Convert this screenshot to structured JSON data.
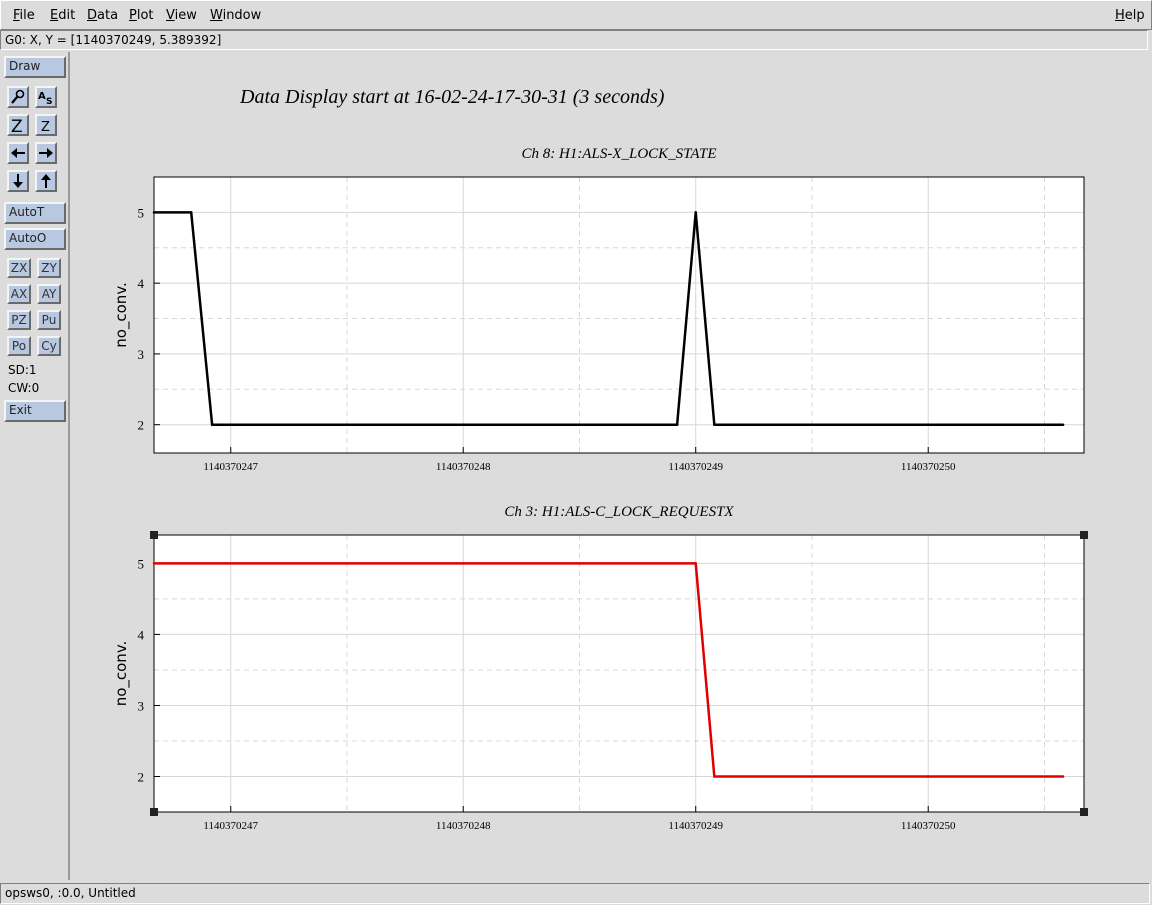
{
  "menu": {
    "file": "File",
    "edit": "Edit",
    "data": "Data",
    "plot": "Plot",
    "view": "View",
    "window": "Window",
    "help": "Help"
  },
  "coord_readout": "G0: X, Y = [1140370249, 5.389392]",
  "sidebar": {
    "draw": "Draw",
    "autot": "AutoT",
    "autoo": "AutoO",
    "zx": "ZX",
    "zy": "ZY",
    "ax": "AX",
    "ay": "AY",
    "pz": "PZ",
    "pu": "Pu",
    "po": "Po",
    "cy": "Cy",
    "sd": "SD:1",
    "cw": "CW:0",
    "exit": "Exit",
    "icons": [
      "zoom-icon",
      "text-tool-icon",
      "zoom-in-z-icon",
      "zoom-out-z-icon",
      "arrow-left-icon",
      "arrow-right-icon",
      "arrow-down-icon",
      "arrow-up-icon"
    ]
  },
  "page_title": "Data Display start at 16-02-24-17-30-31 (3 seconds)",
  "status_bottom": "opsws0, :0.0, Untitled",
  "chart_data": [
    {
      "type": "line",
      "title": "Ch 8: H1:ALS-X_LOCK_STATE",
      "ylabel": "no_conv.",
      "xlabel": "",
      "xlim": [
        1140370246.67,
        1140370250.67
      ],
      "ylim": [
        1.6,
        5.5
      ],
      "xticks": [
        1140370247,
        1140370248,
        1140370249,
        1140370250
      ],
      "xtick_labels": [
        "1140370247",
        "1140370248",
        "1140370249",
        "1140370250"
      ],
      "yticks": [
        2,
        3,
        4,
        5
      ],
      "ytick_labels": [
        "2",
        "3",
        "4",
        "5"
      ],
      "grid": true,
      "color": "#000000",
      "x": [
        1140370246.67,
        1140370246.83,
        1140370246.92,
        1140370248.92,
        1140370249.0,
        1140370249.08,
        1140370250.58
      ],
      "y": [
        5,
        5,
        2,
        2,
        5,
        2,
        2
      ]
    },
    {
      "type": "line",
      "title": "Ch 3: H1:ALS-C_LOCK_REQUESTX",
      "ylabel": "no_conv.",
      "xlabel": "",
      "xlim": [
        1140370246.67,
        1140370250.67
      ],
      "ylim": [
        1.5,
        5.4
      ],
      "xticks": [
        1140370247,
        1140370248,
        1140370249,
        1140370250
      ],
      "xtick_labels": [
        "1140370247",
        "1140370248",
        "1140370249",
        "1140370250"
      ],
      "yticks": [
        2,
        3,
        4,
        5
      ],
      "ytick_labels": [
        "2",
        "3",
        "4",
        "5"
      ],
      "grid": true,
      "color": "#e00000",
      "x": [
        1140370246.67,
        1140370249.0,
        1140370249.08,
        1140370250.58
      ],
      "y": [
        5,
        5,
        2,
        2
      ]
    }
  ]
}
